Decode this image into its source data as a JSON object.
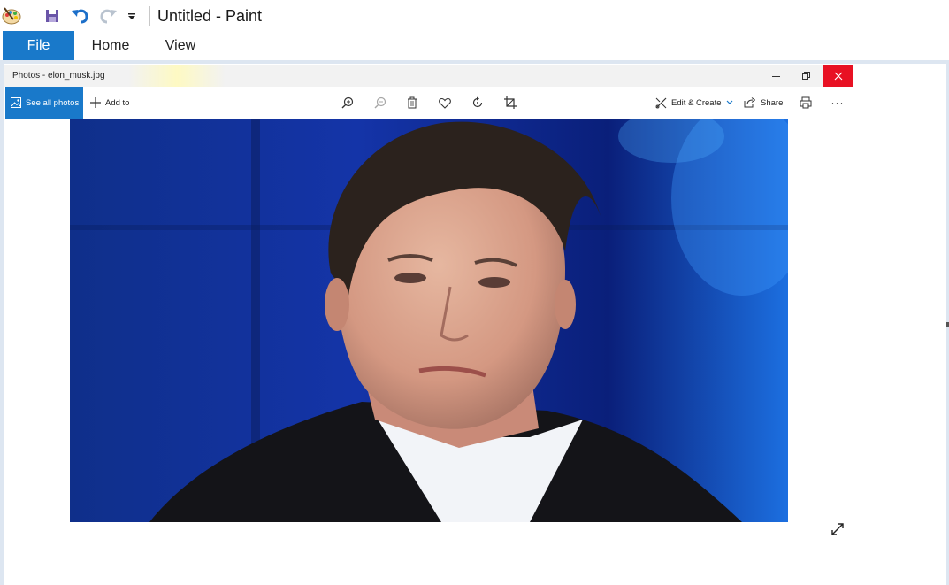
{
  "app": {
    "window_title": "Untitled - Paint"
  },
  "quick_access": {
    "icons": [
      "paint-app-icon",
      "save-icon",
      "undo-icon",
      "redo-icon",
      "customize-quick-access-icon"
    ]
  },
  "ribbon": {
    "tabs": [
      {
        "label": "File",
        "active": true
      },
      {
        "label": "Home",
        "active": false
      },
      {
        "label": "View",
        "active": false
      }
    ],
    "accent_color": "#1979ca"
  },
  "photos_window": {
    "title": "Photos - elon_musk.jpg",
    "close_color": "#e81123",
    "toolbar": {
      "see_all_label": "See all photos",
      "add_to_label": "Add to",
      "icons": [
        "zoom-in-icon",
        "zoom-out-icon",
        "delete-icon",
        "favorite-icon",
        "rotate-icon",
        "crop-icon"
      ],
      "edit_create_label": "Edit & Create",
      "share_label": "Share",
      "more_label": "···"
    },
    "image": {
      "filename": "elon_musk.jpg",
      "description_icon": "portrait-photo"
    }
  }
}
